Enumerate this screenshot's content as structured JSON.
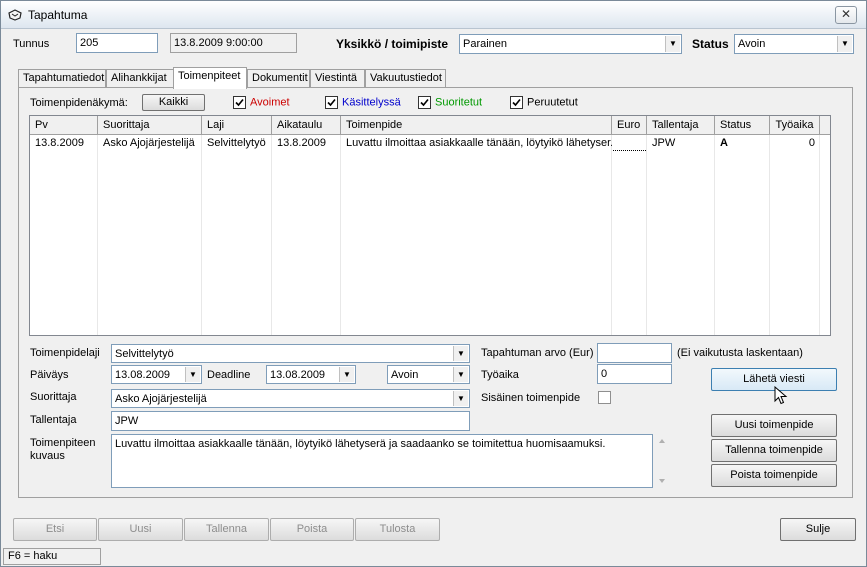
{
  "window": {
    "title": "Tapahtuma",
    "close_symbol": "✕"
  },
  "header": {
    "tunnus_label": "Tunnus",
    "tunnus_value": "205",
    "datetime_value": "13.8.2009 9:00:00",
    "yksikko_label": "Yksikkö / toimipiste",
    "yksikko_value": "Parainen",
    "status_label": "Status",
    "status_value": "Avoin"
  },
  "tabs": [
    {
      "label": "Tapahtumatiedot"
    },
    {
      "label": "Alihankkijat"
    },
    {
      "label": "Toimenpiteet"
    },
    {
      "label": "Dokumentit"
    },
    {
      "label": "Viestintä"
    },
    {
      "label": "Vakuutustiedot"
    }
  ],
  "filter": {
    "view_label": "Toimenpidenäkymä:",
    "all_button": "Kaikki",
    "avoimet": {
      "label": "Avoimet",
      "checked": true,
      "color": "#cc0000"
    },
    "kasittelyssa": {
      "label": "Käsittelyssä",
      "checked": true,
      "color": "#0000cc"
    },
    "suoritetut": {
      "label": "Suoritetut",
      "checked": true,
      "color": "#009900"
    },
    "peruutetut": {
      "label": "Peruutetut",
      "checked": true,
      "color": "#000000"
    }
  },
  "grid": {
    "columns": [
      "Pv",
      "Suorittaja",
      "Laji",
      "Aikataulu",
      "Toimenpide",
      "Euro",
      "Tallentaja",
      "Status",
      "Työaika"
    ],
    "rows": [
      {
        "pv": "13.8.2009",
        "suorittaja": "Asko Ajojärjestelijä",
        "laji": "Selvittelytyö",
        "aikataulu": "13.8.2009",
        "toimenpide": "Luvattu ilmoittaa asiakkaalle tänään, löytyikö lähetyser...",
        "euro": "",
        "tallentaja": "JPW",
        "status": "A",
        "tyoaika": "0"
      }
    ]
  },
  "form": {
    "laji_label": "Toimenpidelaji",
    "laji_value": "Selvittelytyö",
    "paivays_label": "Päiväys",
    "paivays_value": "13.08.2009",
    "deadline_label": "Deadline",
    "deadline_value": "13.08.2009",
    "status_value": "Avoin",
    "suorittaja_label": "Suorittaja",
    "suorittaja_value": "Asko Ajojärjestelijä",
    "tallentaja_label": "Tallentaja",
    "tallentaja_value": "JPW",
    "kuvaus_label_1": "Toimenpiteen",
    "kuvaus_label_2": "kuvaus",
    "kuvaus_value": "Luvattu ilmoittaa asiakkaalle tänään, löytyikö lähetyserä ja saadaanko se toimitettua huomisaamuksi.",
    "arvo_label": "Tapahtuman arvo (Eur)",
    "arvo_value": "",
    "arvo_note": "(Ei vaikutusta laskentaan)",
    "tyoaika_label": "Työaika",
    "tyoaika_value": "0",
    "sisainen_label": "Sisäinen toimenpide",
    "sisainen_checked": false
  },
  "action_buttons": {
    "laheta": "Lähetä viesti",
    "uusi_toimenpide": "Uusi toimenpide",
    "tallenna_toimenpide": "Tallenna toimenpide",
    "poista_toimenpide": "Poista toimenpide"
  },
  "bottom_buttons": {
    "etsi": "Etsi",
    "uusi": "Uusi",
    "tallenna": "Tallenna",
    "poista": "Poista",
    "tulosta": "Tulosta",
    "sulje": "Sulje"
  },
  "statusbar": {
    "hint": "F6 = haku"
  }
}
